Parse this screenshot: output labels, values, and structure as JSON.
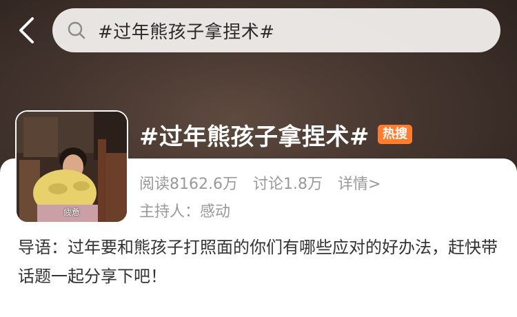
{
  "search": {
    "query": "#过年熊孩子拿捏术#"
  },
  "topic": {
    "title": "#过年熊孩子拿捏术#",
    "badge": "热搜",
    "avatar_caption": "疲惫"
  },
  "stats": {
    "reads": "阅读8162.6万",
    "discussions": "讨论1.8万",
    "details": "详情>"
  },
  "host": "主持人：感动",
  "intro": "导语：过年要和熊孩子打照面的你们有哪些应对的好办法，赶快带话题一起分享下吧！",
  "colors": {
    "badge": "#ff7d2c",
    "header_bg": "#473730",
    "muted_text": "#999999"
  }
}
